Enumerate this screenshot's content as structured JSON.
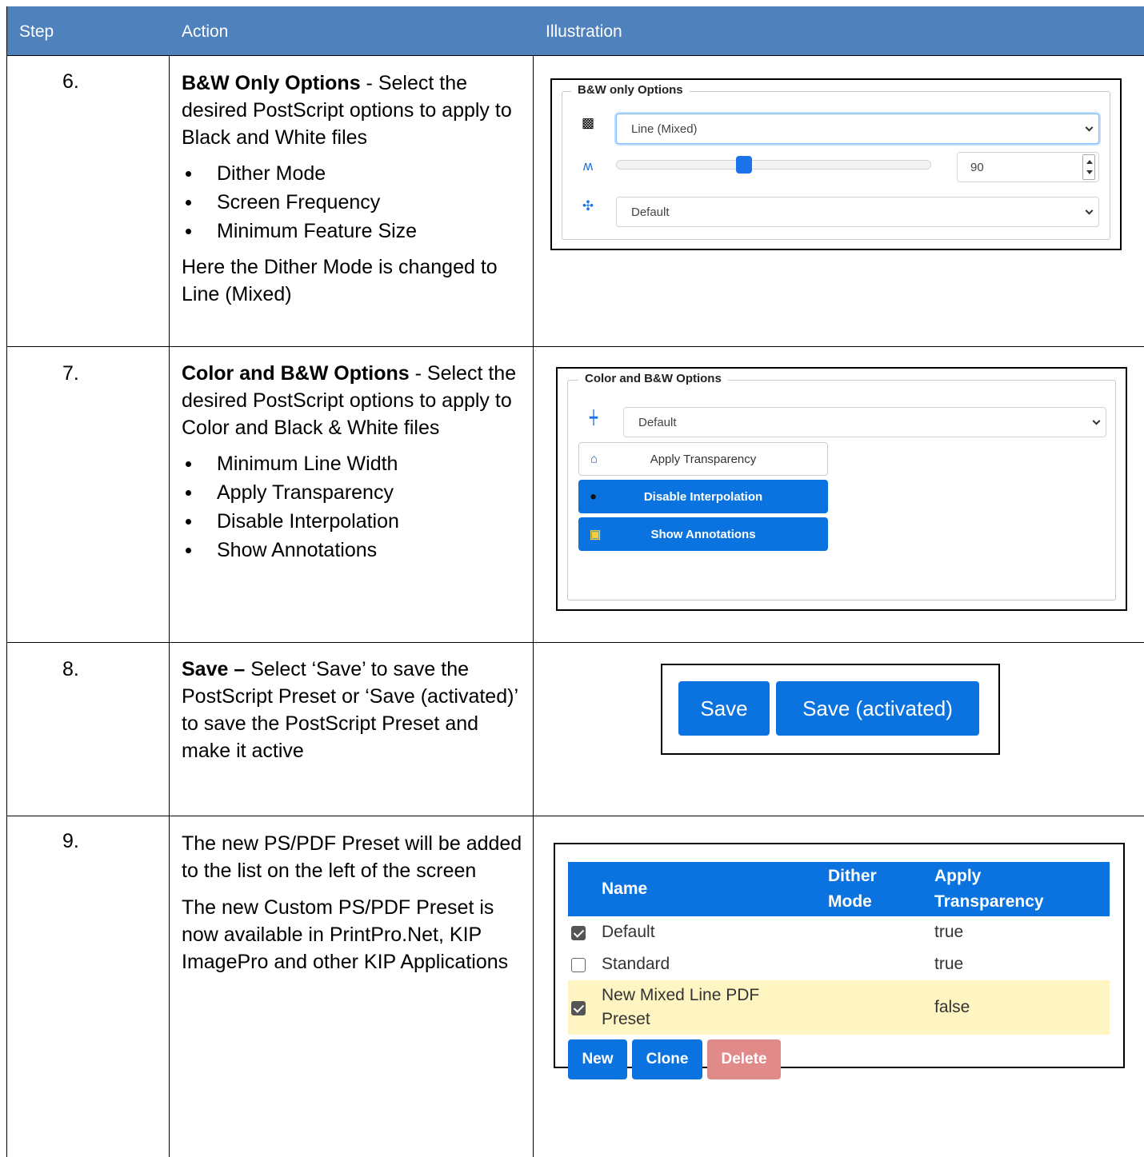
{
  "header": {
    "step": "Step",
    "action": "Action",
    "illustration": "Illustration"
  },
  "rows": [
    {
      "step": "6.",
      "title": "B&W Only Options",
      "intro": " - Select the desired PostScript options to apply to Black and White files",
      "bullets": [
        "Dither Mode",
        "Screen Frequency",
        "Minimum Feature Size"
      ],
      "note": "Here the Dither Mode is changed to Line (Mixed)"
    },
    {
      "step": "7.",
      "title": "Color and B&W Options",
      "intro": " - Select the desired PostScript options to apply to Color and Black & White files",
      "bullets": [
        "Minimum Line Width",
        "Apply Transparency",
        "Disable Interpolation",
        "Show Annotations"
      ]
    },
    {
      "step": "8.",
      "title": "Save –",
      "intro": " Select ‘Save’ to save the PostScript Preset or ‘Save (activated)’ to save the PostScript Preset and make it active"
    },
    {
      "step": "9.",
      "intro": "The new PS/PDF Preset will be added to the list on the left of the screen",
      "note": "The new Custom PS/PDF Preset is now available in PrintPro.Net, KIP ImagePro and other KIP Applications"
    }
  ],
  "bw_panel": {
    "legend": "B&W only Options",
    "dither_mode": "Line (Mixed)",
    "screen_frequency": "90",
    "slider_fraction": 0.4,
    "min_feature_size": "Default"
  },
  "color_panel": {
    "legend": "Color and B&W Options",
    "min_line_width": "Default",
    "apply_transparency": "Apply Transparency",
    "disable_interpolation": "Disable Interpolation",
    "show_annotations": "Show Annotations"
  },
  "save_panel": {
    "save": "Save",
    "save_activated": "Save (activated)"
  },
  "preset_table": {
    "columns": [
      "Name",
      "Dither Mode",
      "Apply Transparency"
    ],
    "rows": [
      {
        "checked": true,
        "name": "Default",
        "dither": "",
        "transparency": "true"
      },
      {
        "checked": false,
        "name": "Standard",
        "dither": "",
        "transparency": "true"
      },
      {
        "checked": true,
        "name": "New Mixed Line PDF Preset",
        "dither": "",
        "transparency": "false"
      }
    ],
    "buttons": {
      "new": "New",
      "clone": "Clone",
      "delete": "Delete"
    }
  },
  "colors": {
    "header_bg": "#4f81bd",
    "button_blue": "#0a73e0",
    "delete_disabled": "#e08a8a",
    "selected_row": "#fff5c2"
  }
}
